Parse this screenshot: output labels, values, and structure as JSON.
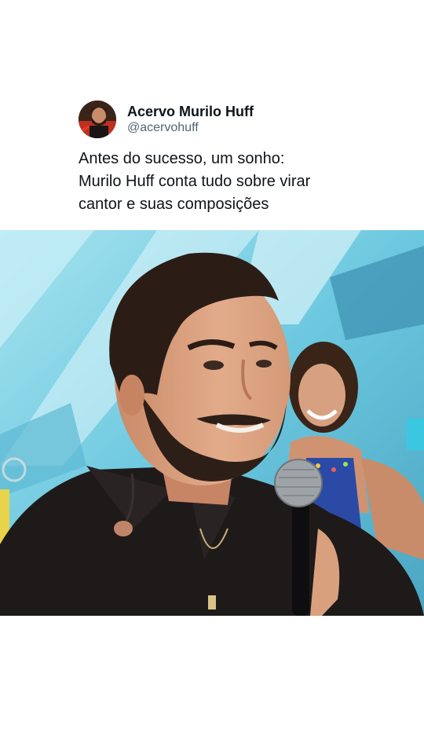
{
  "post": {
    "author_name": "Acervo Murilo Huff",
    "author_handle": "@acervohuff",
    "text_lines": [
      "Antes do sucesso, um sonho:",
      "Murilo Huff conta tudo sobre virar",
      "cantor e suas composições"
    ]
  },
  "media": {
    "type": "video-frame",
    "dominant_colors": {
      "background": "#7fd3e6",
      "shirt": "#1f1a1a",
      "skin": "#d9a07e",
      "hair": "#2b1d16",
      "microphone": "#9ea3a8"
    }
  },
  "icons": {
    "avatar": "profile-photo-icon"
  }
}
